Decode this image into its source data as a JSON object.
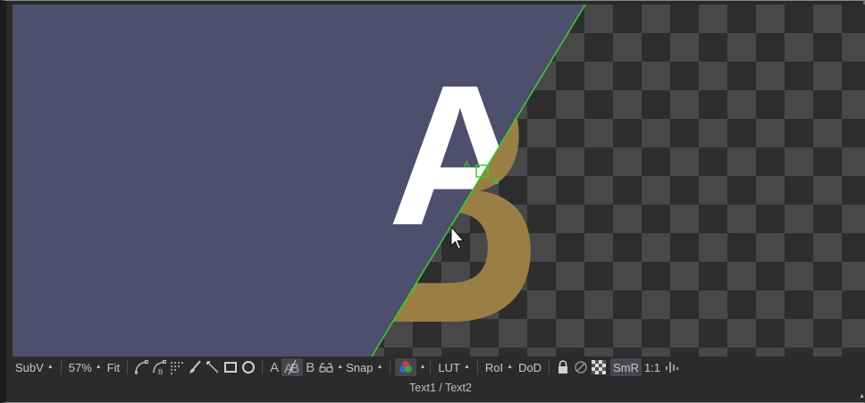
{
  "toolbar": {
    "subview_label": "SubV",
    "zoom_label": "57%",
    "fit_label": "Fit",
    "buffer_a_label": "A",
    "buffer_ab_label": "AB",
    "buffer_b_label": "B",
    "snap_label": "Snap",
    "lut_label": "LUT",
    "roi_label": "RoI",
    "dod_label": "DoD",
    "smr_label": "SmR",
    "ratio_label": "1:1"
  },
  "statusbar": {
    "text": "Text1 / Text2"
  },
  "viewer": {
    "split_marker_a": "A",
    "split_marker_b": "B",
    "text_a": "A",
    "text_b": "B",
    "colors": {
      "background_a": "#4e4f6d",
      "text_a": "#ffffff",
      "text_b": "#9a7f45",
      "checker_dark": "#2d2d2d",
      "checker_light": "#484848",
      "split_line": "#39d12e"
    }
  }
}
